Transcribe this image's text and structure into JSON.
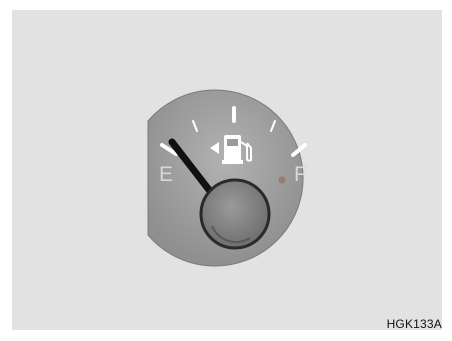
{
  "figure_code": "HGK133A",
  "gauge": {
    "empty_label": "E",
    "full_label": "F",
    "icon": "fuel-pump-icon",
    "pointer_level": 0,
    "fuel_door_side_indicator": "left-arrow-icon",
    "colors": {
      "panel": "#e2e2e2",
      "face": "#a2a2a2",
      "needle": "#111111",
      "ticks": "#ffffff",
      "labels": "#dcdcdc",
      "warning_dot": "#9a7a6a"
    }
  }
}
